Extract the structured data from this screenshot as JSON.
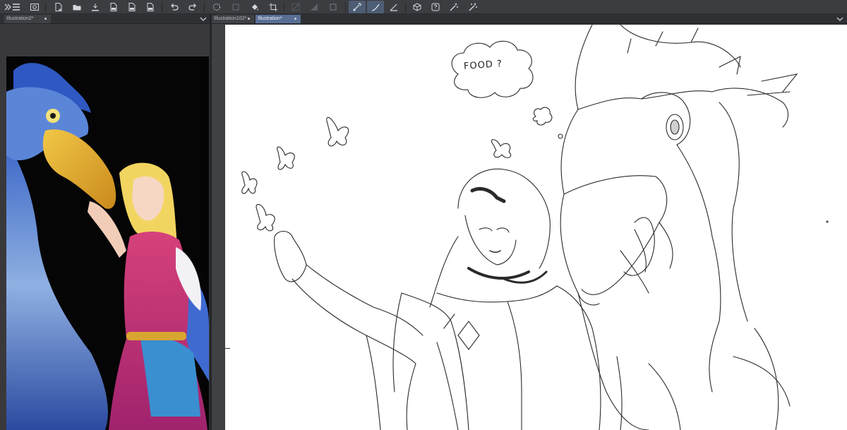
{
  "toolbar": {
    "buttons": [
      {
        "name": "menu-icon",
        "active": false
      },
      {
        "name": "navigator-icon",
        "active": false
      },
      {
        "name": "new-file-icon",
        "active": false
      },
      {
        "name": "open-folder-icon",
        "active": false
      },
      {
        "name": "save-icon",
        "active": false
      },
      {
        "name": "export-jpg-icon",
        "active": false
      },
      {
        "name": "export-png-icon",
        "active": false
      },
      {
        "name": "export-psd-icon",
        "active": false
      },
      {
        "name": "undo-icon",
        "active": false
      },
      {
        "name": "redo-icon",
        "active": false
      },
      {
        "name": "loading-icon",
        "active": false
      },
      {
        "name": "layer-clear-icon",
        "active": false
      },
      {
        "name": "fill-icon",
        "active": false
      },
      {
        "name": "crop-icon",
        "active": false
      },
      {
        "name": "ruler-disabled-icon",
        "active": false
      },
      {
        "name": "gradient-disabled-icon",
        "active": false
      },
      {
        "name": "square-disabled-icon",
        "active": false
      },
      {
        "name": "stabilizer-pen-icon",
        "active": true
      },
      {
        "name": "smooth-pen-icon",
        "active": true
      },
      {
        "name": "line-tool-icon",
        "active": false
      },
      {
        "name": "3d-layer-icon",
        "active": false
      },
      {
        "name": "help-icon",
        "active": false
      },
      {
        "name": "auto-select-icon",
        "active": false
      },
      {
        "name": "magic-wand-icon",
        "active": false
      }
    ],
    "expand_icon": "chevron-double-right-icon"
  },
  "left_tabs": [
    {
      "label": "Illustration2*",
      "active": false
    }
  ],
  "right_tabs": [
    {
      "label": "Illustration102*",
      "active": false
    },
    {
      "label": "Illustration*",
      "active": true
    }
  ],
  "canvas": {
    "thought_bubble_text": "FOOD ?"
  },
  "colors": {
    "toolbar_bg": "#3c3d41",
    "active_tab": "#586e94",
    "active_tool": "#4d5d74",
    "canvas_bg": "#ffffff"
  }
}
